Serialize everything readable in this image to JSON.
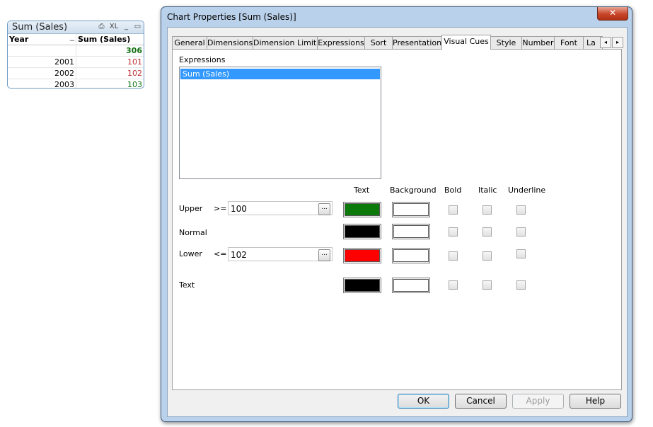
{
  "table_chart": {
    "title": "Sum (Sales)",
    "icons": [
      "print-icon",
      "xl-icon",
      "minimize-icon",
      "maximize-icon"
    ],
    "icon_glyphs": {
      "print": "⎙",
      "xl": "XL",
      "minimize": "_",
      "maximize": "▭"
    },
    "headers": [
      "Year",
      "Sum (Sales)"
    ],
    "total": "306",
    "rows": [
      {
        "year": "2001",
        "value": "101"
      },
      {
        "year": "2002",
        "value": "102"
      },
      {
        "year": "2003",
        "value": "103"
      }
    ],
    "colors": {
      "total": "#107010",
      "upper": "#107010",
      "lower": "#c03030"
    }
  },
  "dialog": {
    "title": "Chart Properties [Sum (Sales)]",
    "close_glyph": "✕",
    "tabs": [
      "General",
      "Dimensions",
      "Dimension Limits",
      "Expressions",
      "Sort",
      "Presentation",
      "Visual Cues",
      "Style",
      "Number",
      "Font",
      "La"
    ],
    "active_tab": "Visual Cues",
    "tab_scroll": [
      "◂",
      "▸"
    ],
    "expressions_label": "Expressions",
    "expressions": [
      "Sum (Sales)"
    ],
    "columns": {
      "text": "Text",
      "background": "Background",
      "bold": "Bold",
      "italic": "Italic",
      "underline": "Underline"
    },
    "rows": {
      "upper": {
        "label": "Upper",
        "op": ">=",
        "value": "100",
        "text_color": "#0b7a0b",
        "bg_color": "#ffffff"
      },
      "normal": {
        "label": "Normal",
        "text_color": "#000000",
        "bg_color": "#ffffff"
      },
      "lower": {
        "label": "Lower",
        "op": "<=",
        "value": "102",
        "text_color": "#ff0000",
        "bg_color": "#ffffff"
      },
      "text": {
        "label": "Text",
        "text_color": "#000000",
        "bg_color": "#ffffff"
      }
    },
    "ellipsis": "...",
    "buttons": {
      "ok": "OK",
      "cancel": "Cancel",
      "apply": "Apply",
      "help": "Help"
    }
  }
}
